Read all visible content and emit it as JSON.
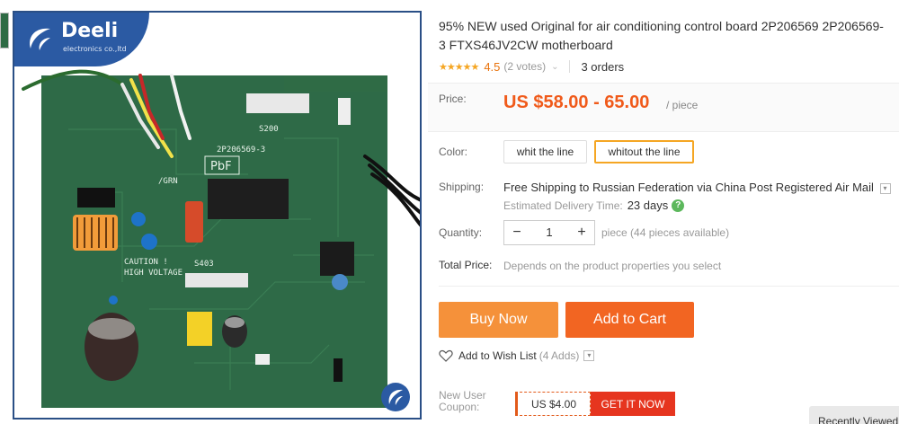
{
  "brand": {
    "name": "Deeli",
    "tagline": "electronics co.,ltd"
  },
  "product": {
    "title_line1": "95% NEW used Original for air conditioning control board 2P206569 2P206569-",
    "title_line2": "3 FTXS46JV2CW motherboard",
    "rating": "4.5",
    "votes": "(2 votes)",
    "orders": "3 orders"
  },
  "board_markings": {
    "part_no": "2P206569-3",
    "pbf": "PbF",
    "caution": "CAUTION !",
    "high_voltage": "HIGH VOLTAGE",
    "s403": "S403",
    "s200": "S200",
    "grn": "/GRN"
  },
  "price": {
    "label": "Price:",
    "value": "US $58.00 - 65.00",
    "unit": "/ piece"
  },
  "color": {
    "label": "Color:",
    "options": [
      "whit the line",
      "whitout the line"
    ],
    "selected": "whitout the line"
  },
  "shipping": {
    "label": "Shipping:",
    "free": "Free Shipping to",
    "destination": "Russian Federation via China Post Registered Air Mail",
    "delivery_label": "Estimated Delivery Time:",
    "delivery_days": "23  days"
  },
  "quantity": {
    "label": "Quantity:",
    "value": "1",
    "info": "piece (44 pieces available)"
  },
  "total": {
    "label": "Total Price:",
    "info": "Depends on the product properties you select"
  },
  "actions": {
    "buy_now": "Buy Now",
    "add_to_cart": "Add to Cart"
  },
  "wishlist": {
    "label": "Add to Wish List",
    "count": "(4 Adds)"
  },
  "coupon": {
    "label_line1": "New User",
    "label_line2": "Coupon:",
    "amount": "US $4.00",
    "cta": "GET IT NOW"
  },
  "recently_viewed": "Recently Viewed",
  "colors": {
    "price": "#f05a1a",
    "buy": "#f5913a",
    "cart": "#f26522",
    "coupon": "#e6351f",
    "brand": "#2b5aa3",
    "pcb": "#2f6b45"
  }
}
